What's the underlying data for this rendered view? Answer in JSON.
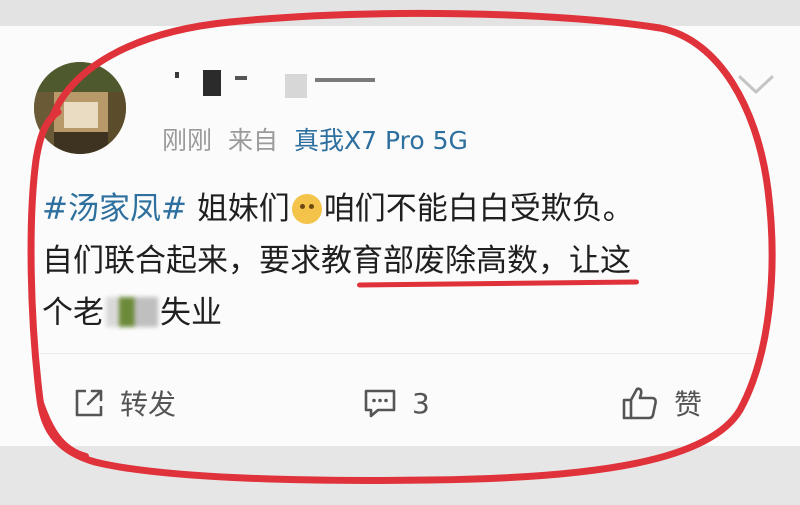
{
  "post": {
    "meta": {
      "time": "刚刚",
      "source_prefix": "来自",
      "device": "真我X7 Pro 5G"
    },
    "content": {
      "hashtag": "#汤家凤#",
      "text_before_emoji": "姐妹们",
      "text_after_emoji": "咱们不能白白受欺负。",
      "line2_start": "自们联合起来，要求",
      "line2_underlined": "教育部废除高数",
      "line2_end": "，让这",
      "line3_start": "个老",
      "line3_end": "失业"
    },
    "actions": {
      "forward_label": "转发",
      "comment_count": "3",
      "like_label": "赞"
    },
    "icons": {
      "forward": "share-arrow-icon",
      "comment": "comment-bubble-icon",
      "like": "thumbs-up-icon",
      "more": "chevron-down-icon"
    }
  },
  "colors": {
    "link": "#2d6f9e",
    "annotation_red": "#e0323a",
    "meta_gray": "#9a9a9a"
  }
}
